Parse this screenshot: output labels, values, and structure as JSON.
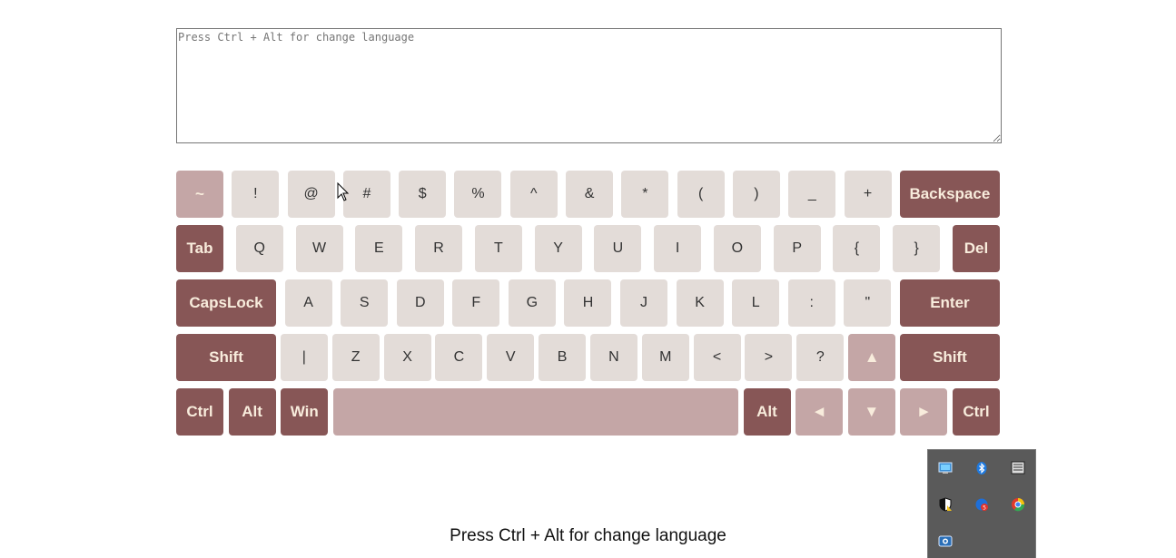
{
  "textarea": {
    "placeholder": "Press Ctrl + Alt for change language",
    "value": ""
  },
  "keyboard": {
    "row1": [
      "~",
      "!",
      "@",
      "#",
      "$",
      "%",
      "^",
      "&",
      "*",
      "(",
      ")",
      "_",
      "+",
      "Backspace"
    ],
    "row2": [
      "Tab",
      "Q",
      "W",
      "E",
      "R",
      "T",
      "Y",
      "U",
      "I",
      "O",
      "P",
      "{",
      "}",
      "Del"
    ],
    "row3": [
      "CapsLock",
      "A",
      "S",
      "D",
      "F",
      "G",
      "H",
      "J",
      "K",
      "L",
      ":",
      "\"",
      "Enter"
    ],
    "row4": [
      "Shift",
      "|",
      "Z",
      "X",
      "C",
      "V",
      "B",
      "N",
      "M",
      "<",
      ">",
      "?",
      "▲",
      "Shift"
    ],
    "row5": [
      "Ctrl",
      "Alt",
      "Win",
      "",
      "Alt",
      "◄",
      "▼",
      "►",
      "Ctrl"
    ]
  },
  "footer": {
    "hint": "Press Ctrl + Alt for change language"
  },
  "colors": {
    "key_light": "#e3dcd8",
    "key_dark": "#875656",
    "key_mid": "#c4a6a6",
    "key_label_light": "#f8ecdc"
  },
  "tray": {
    "icons": [
      "network-monitor-icon",
      "bluetooth-icon",
      "display-icon",
      "security-shield-icon",
      "notification-app-icon",
      "browser-icon",
      "camera-icon"
    ]
  }
}
